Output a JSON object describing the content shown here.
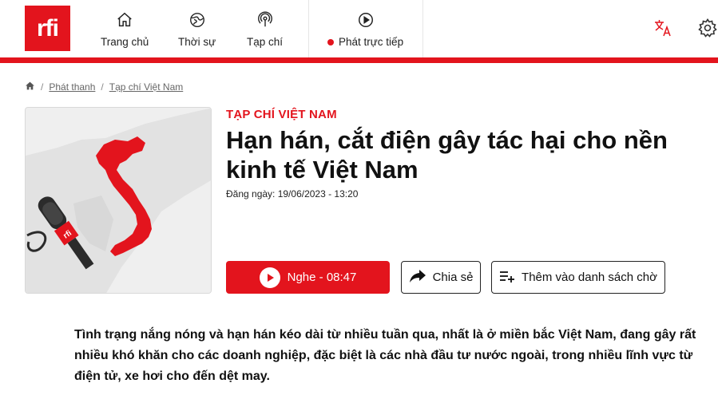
{
  "brand": {
    "logo_text": "rfi",
    "accent_color": "#e3141d"
  },
  "nav": {
    "items": [
      {
        "label": "Trang chủ",
        "icon": "home-icon"
      },
      {
        "label": "Thời sự",
        "icon": "globe-icon"
      },
      {
        "label": "Tạp chí",
        "icon": "podcast-icon"
      },
      {
        "label": "Phát trực tiếp",
        "icon": "play-circle-icon"
      }
    ],
    "right_icons": [
      "translate-icon",
      "gear-icon"
    ]
  },
  "breadcrumb": {
    "home_icon": "home-icon",
    "items": [
      "Phát thanh",
      "Tạp chí Việt Nam"
    ],
    "separator": "/"
  },
  "article": {
    "kicker": "TẠP CHÍ VIỆT NAM",
    "title": "Hạn hán, cắt điện gây tác hại cho nền kinh tế Việt Nam",
    "date": "Đăng ngày: 19/06/2023 - 13:20",
    "lead": "Tình trạng nắng nóng và hạn hán kéo dài từ nhiều tuần qua, nhất là ở miền bắc Việt Nam, đang gây rất nhiều khó khăn cho các doanh nghiệp, đặc biệt là các nhà đầu tư nước ngoài, trong nhiều lĩnh vực từ điện tử, xe hơi cho đến dệt may."
  },
  "actions": {
    "listen": "Nghe - 08:47",
    "share": "Chia sẻ",
    "playlist": "Thêm vào danh sách chờ"
  },
  "thumbnail": {
    "mic_badge_text": "rfi"
  }
}
